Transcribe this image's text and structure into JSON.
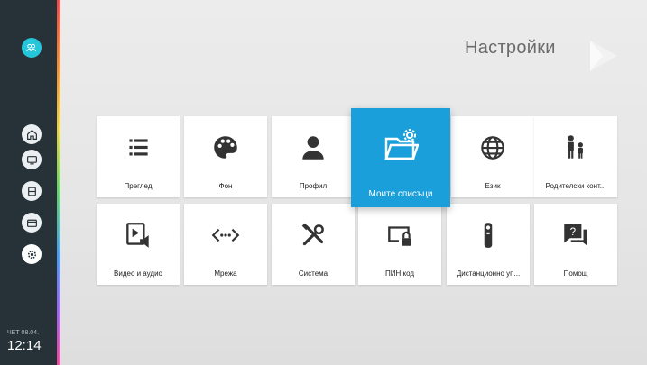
{
  "header": {
    "title": "Настройки"
  },
  "sidebar": {
    "avatar_icon": "profile-group-icon",
    "items": [
      {
        "icon": "home-icon"
      },
      {
        "icon": "tv-input-icon"
      },
      {
        "icon": "apps-icon"
      },
      {
        "icon": "media-icon"
      },
      {
        "icon": "settings-icon",
        "active": true
      }
    ],
    "clock": {
      "date": "ЧЕТ 08.04.",
      "time": "12:14"
    }
  },
  "tiles": [
    {
      "label": "Преглед",
      "icon": "list-icon"
    },
    {
      "label": "Фон",
      "icon": "palette-icon"
    },
    {
      "label": "Профил",
      "icon": "person-icon"
    },
    {
      "label": "Моите списъци",
      "icon": "folder-settings-icon",
      "focused": true
    },
    {
      "label": "Език",
      "icon": "globe-icon"
    },
    {
      "label": "Родителски конт...",
      "icon": "family-icon"
    },
    {
      "label": "Видео и аудио",
      "icon": "video-audio-icon"
    },
    {
      "label": "Мрежа",
      "icon": "network-code-icon"
    },
    {
      "label": "Система",
      "icon": "tools-icon"
    },
    {
      "label": "ПИН код",
      "icon": "pin-lock-icon"
    },
    {
      "label": "Дистанционно уп...",
      "icon": "remote-icon"
    },
    {
      "label": "Помощ",
      "icon": "help-chat-icon"
    }
  ],
  "colors": {
    "focus": "#1a9fdb",
    "sidebar": "#263238",
    "icon": "#333333"
  }
}
